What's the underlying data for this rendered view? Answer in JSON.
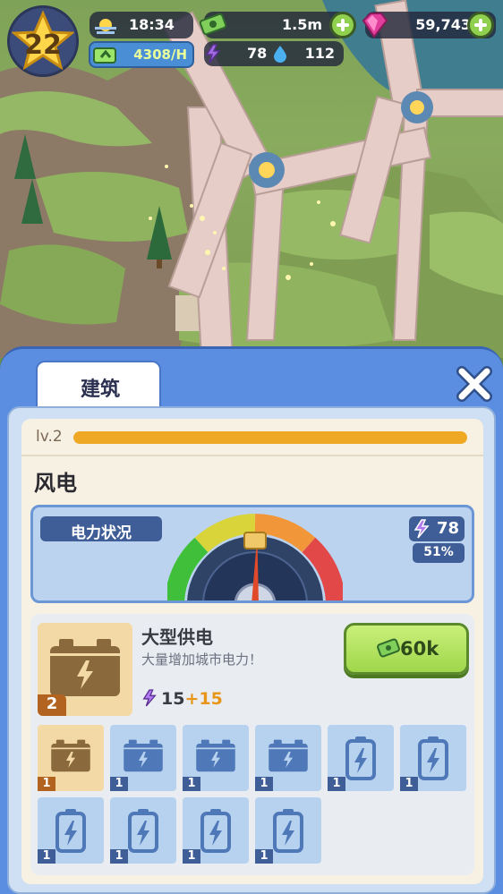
{
  "hud": {
    "level": "22",
    "time": "18:34",
    "cash": "1.5m",
    "gems": "59,743",
    "income": "4308/H",
    "energy": "78",
    "water": "112",
    "colors": {
      "cash_pill": "#23283c",
      "plus": "#8fd14f",
      "gem": "#e23e9c"
    }
  },
  "panel": {
    "tab_label": "建筑",
    "level_label": "lv.2",
    "level_progress": 1.0,
    "building_name": "风电",
    "power": {
      "label": "电力状况",
      "value": "78",
      "percent": "51%",
      "gauge_level": 0.51
    },
    "upgrade": {
      "title": "大型供电",
      "description": "大量增加城市电力！",
      "level": "2",
      "stat_base": "15",
      "stat_bonus": "+15",
      "price": "60k"
    },
    "slots": [
      {
        "count": "1",
        "icon": "generator-icon",
        "state": "active"
      },
      {
        "count": "1",
        "icon": "generator-icon",
        "state": "locked"
      },
      {
        "count": "1",
        "icon": "generator-icon",
        "state": "locked"
      },
      {
        "count": "1",
        "icon": "generator-icon",
        "state": "locked"
      },
      {
        "count": "1",
        "icon": "battery-icon",
        "state": "locked"
      },
      {
        "count": "1",
        "icon": "battery-icon",
        "state": "locked"
      },
      {
        "count": "1",
        "icon": "battery-icon",
        "state": "locked"
      },
      {
        "count": "1",
        "icon": "battery-icon",
        "state": "locked"
      },
      {
        "count": "1",
        "icon": "battery-icon",
        "state": "locked"
      },
      {
        "count": "1",
        "icon": "battery-icon",
        "state": "locked"
      }
    ]
  }
}
